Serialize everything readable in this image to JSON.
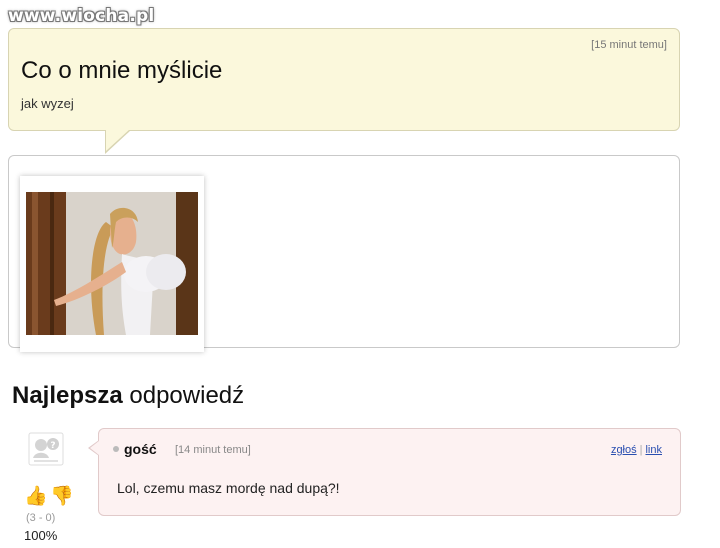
{
  "watermark": "www.wiocha.pl",
  "question": {
    "time": "[15 minut temu]",
    "title": "Co o mnie myślicie",
    "subtitle": "jak wyzej"
  },
  "best_answer": {
    "heading_bold": "Najlepsza",
    "heading_rest": " odpowiedź",
    "author": "gość",
    "time": "[14 minut temu]",
    "report_label": "zgłoś",
    "link_label": "link",
    "text": "Lol, czemu masz mordę nad dupą?!",
    "score": "(3 - 0)",
    "percent": "100%"
  },
  "icons": {
    "thumb_up": "thumb-up-icon",
    "thumb_down": "thumb-down-icon",
    "avatar": "avatar-placeholder-icon"
  },
  "colors": {
    "question_bg": "#fbf8dc",
    "answer_bg": "#fdf2f2",
    "link": "#2a4fb0"
  }
}
